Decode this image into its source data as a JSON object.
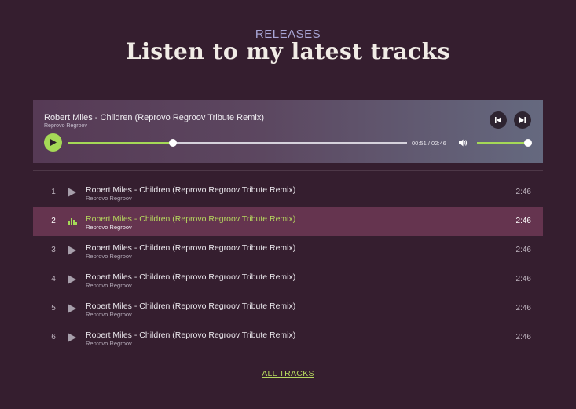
{
  "section": {
    "eyebrow": "RELEASES",
    "headline": "Listen to my latest tracks"
  },
  "player": {
    "track_title": "Robert Miles - Children (Reprovo Regroov Tribute Remix)",
    "artist": "Reprovo Regroov",
    "time_display": "00:51 / 02:46",
    "progress_fraction": 0.31,
    "volume_fraction": 1.0,
    "icons": {
      "prev": "skip-previous-icon",
      "next": "skip-next-icon",
      "play": "play-icon",
      "volume": "volume-icon"
    }
  },
  "tracks": [
    {
      "number": "1",
      "title": "Robert Miles - Children (Reprovo Regroov Tribute Remix)",
      "artist": "Reprovo Regroov",
      "duration": "2:46",
      "state": "idle"
    },
    {
      "number": "2",
      "title": "Robert Miles - Children (Reprovo Regroov Tribute Remix)",
      "artist": "Reprovo Regroov",
      "duration": "2:46",
      "state": "playing"
    },
    {
      "number": "3",
      "title": "Robert Miles - Children (Reprovo Regroov Tribute Remix)",
      "artist": "Reprovo Regroov",
      "duration": "2:46",
      "state": "idle"
    },
    {
      "number": "4",
      "title": "Robert Miles - Children (Reprovo Regroov Tribute Remix)",
      "artist": "Reprovo Regroov",
      "duration": "2:46",
      "state": "idle"
    },
    {
      "number": "5",
      "title": "Robert Miles - Children (Reprovo Regroov Tribute Remix)",
      "artist": "Reprovo Regroov",
      "duration": "2:46",
      "state": "idle"
    },
    {
      "number": "6",
      "title": "Robert Miles - Children (Reprovo Regroov Tribute Remix)",
      "artist": "Reprovo Regroov",
      "duration": "2:46",
      "state": "idle"
    }
  ],
  "footer": {
    "all_tracks_label": "ALL TRACKS"
  },
  "colors": {
    "background": "#351e2f",
    "accent": "#a5d957",
    "active_row": "#65344f"
  }
}
